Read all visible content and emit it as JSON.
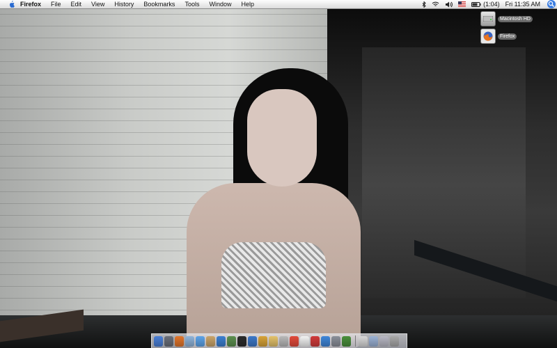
{
  "menubar": {
    "apple_icon": "apple-logo-icon",
    "app_name": "Firefox",
    "menus": [
      "File",
      "Edit",
      "View",
      "History",
      "Bookmarks",
      "Tools",
      "Window",
      "Help"
    ],
    "status": {
      "bluetooth_icon": "bluetooth-icon",
      "wifi_icon": "wifi-icon",
      "volume_icon": "volume-icon",
      "flag_icon": "us-flag-icon",
      "battery": "(1:04)",
      "clock": "Fri 11:35 AM",
      "spotlight_icon": "spotlight-icon"
    }
  },
  "desktop": {
    "icons": [
      {
        "label": "Macintosh HD",
        "icon": "hard-drive-icon"
      },
      {
        "label": "Firefox",
        "icon": "firefox-icon"
      }
    ]
  },
  "dock": {
    "items": [
      {
        "icon": "finder-icon",
        "color": "#4a7fd6"
      },
      {
        "icon": "dashboard-icon",
        "color": "#6a6f7a"
      },
      {
        "icon": "firefox-icon",
        "color": "#e2762c"
      },
      {
        "icon": "mail-icon",
        "color": "#8fb3d9"
      },
      {
        "icon": "ichat-icon",
        "color": "#5da3e8"
      },
      {
        "icon": "address-book-icon",
        "color": "#c9a46a"
      },
      {
        "icon": "itunes-icon",
        "color": "#3c7fd0"
      },
      {
        "icon": "iphoto-icon",
        "color": "#5c8f4f"
      },
      {
        "icon": "imovie-icon",
        "color": "#2b2b2b"
      },
      {
        "icon": "idvd-icon",
        "color": "#3d78c8"
      },
      {
        "icon": "garageband-icon",
        "color": "#d8a338"
      },
      {
        "icon": "folder-icon",
        "color": "#e4c26b"
      },
      {
        "icon": "preview-icon",
        "color": "#b9b9b9"
      },
      {
        "icon": "ical-icon",
        "color": "#e24a3b"
      },
      {
        "icon": "textedit-icon",
        "color": "#f2f2f2"
      },
      {
        "icon": "photo-booth-icon",
        "color": "#d13b3b"
      },
      {
        "icon": "safari-icon",
        "color": "#3f86d9"
      },
      {
        "icon": "system-preferences-icon",
        "color": "#8a8f99"
      },
      {
        "icon": "network-icon",
        "color": "#4a8f3c"
      }
    ],
    "stack_items": [
      {
        "icon": "downloads-stack-icon",
        "color": "#d8d8d8"
      },
      {
        "icon": "documents-stack-icon",
        "color": "#9ab1d4"
      },
      {
        "icon": "applications-stack-icon",
        "color": "#b8b8c4"
      },
      {
        "icon": "trash-icon",
        "color": "#a8a8a8"
      }
    ]
  }
}
